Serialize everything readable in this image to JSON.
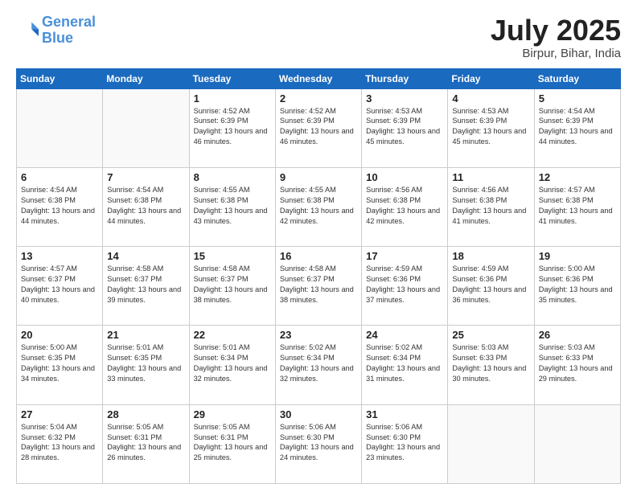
{
  "header": {
    "logo": {
      "line1": "General",
      "line2": "Blue"
    },
    "title": "July 2025",
    "location": "Birpur, Bihar, India"
  },
  "weekdays": [
    "Sunday",
    "Monday",
    "Tuesday",
    "Wednesday",
    "Thursday",
    "Friday",
    "Saturday"
  ],
  "weeks": [
    [
      {
        "day": "",
        "sunrise": "",
        "sunset": "",
        "daylight": ""
      },
      {
        "day": "",
        "sunrise": "",
        "sunset": "",
        "daylight": ""
      },
      {
        "day": "1",
        "sunrise": "Sunrise: 4:52 AM",
        "sunset": "Sunset: 6:39 PM",
        "daylight": "Daylight: 13 hours and 46 minutes."
      },
      {
        "day": "2",
        "sunrise": "Sunrise: 4:52 AM",
        "sunset": "Sunset: 6:39 PM",
        "daylight": "Daylight: 13 hours and 46 minutes."
      },
      {
        "day": "3",
        "sunrise": "Sunrise: 4:53 AM",
        "sunset": "Sunset: 6:39 PM",
        "daylight": "Daylight: 13 hours and 45 minutes."
      },
      {
        "day": "4",
        "sunrise": "Sunrise: 4:53 AM",
        "sunset": "Sunset: 6:39 PM",
        "daylight": "Daylight: 13 hours and 45 minutes."
      },
      {
        "day": "5",
        "sunrise": "Sunrise: 4:54 AM",
        "sunset": "Sunset: 6:39 PM",
        "daylight": "Daylight: 13 hours and 44 minutes."
      }
    ],
    [
      {
        "day": "6",
        "sunrise": "Sunrise: 4:54 AM",
        "sunset": "Sunset: 6:38 PM",
        "daylight": "Daylight: 13 hours and 44 minutes."
      },
      {
        "day": "7",
        "sunrise": "Sunrise: 4:54 AM",
        "sunset": "Sunset: 6:38 PM",
        "daylight": "Daylight: 13 hours and 44 minutes."
      },
      {
        "day": "8",
        "sunrise": "Sunrise: 4:55 AM",
        "sunset": "Sunset: 6:38 PM",
        "daylight": "Daylight: 13 hours and 43 minutes."
      },
      {
        "day": "9",
        "sunrise": "Sunrise: 4:55 AM",
        "sunset": "Sunset: 6:38 PM",
        "daylight": "Daylight: 13 hours and 42 minutes."
      },
      {
        "day": "10",
        "sunrise": "Sunrise: 4:56 AM",
        "sunset": "Sunset: 6:38 PM",
        "daylight": "Daylight: 13 hours and 42 minutes."
      },
      {
        "day": "11",
        "sunrise": "Sunrise: 4:56 AM",
        "sunset": "Sunset: 6:38 PM",
        "daylight": "Daylight: 13 hours and 41 minutes."
      },
      {
        "day": "12",
        "sunrise": "Sunrise: 4:57 AM",
        "sunset": "Sunset: 6:38 PM",
        "daylight": "Daylight: 13 hours and 41 minutes."
      }
    ],
    [
      {
        "day": "13",
        "sunrise": "Sunrise: 4:57 AM",
        "sunset": "Sunset: 6:37 PM",
        "daylight": "Daylight: 13 hours and 40 minutes."
      },
      {
        "day": "14",
        "sunrise": "Sunrise: 4:58 AM",
        "sunset": "Sunset: 6:37 PM",
        "daylight": "Daylight: 13 hours and 39 minutes."
      },
      {
        "day": "15",
        "sunrise": "Sunrise: 4:58 AM",
        "sunset": "Sunset: 6:37 PM",
        "daylight": "Daylight: 13 hours and 38 minutes."
      },
      {
        "day": "16",
        "sunrise": "Sunrise: 4:58 AM",
        "sunset": "Sunset: 6:37 PM",
        "daylight": "Daylight: 13 hours and 38 minutes."
      },
      {
        "day": "17",
        "sunrise": "Sunrise: 4:59 AM",
        "sunset": "Sunset: 6:36 PM",
        "daylight": "Daylight: 13 hours and 37 minutes."
      },
      {
        "day": "18",
        "sunrise": "Sunrise: 4:59 AM",
        "sunset": "Sunset: 6:36 PM",
        "daylight": "Daylight: 13 hours and 36 minutes."
      },
      {
        "day": "19",
        "sunrise": "Sunrise: 5:00 AM",
        "sunset": "Sunset: 6:36 PM",
        "daylight": "Daylight: 13 hours and 35 minutes."
      }
    ],
    [
      {
        "day": "20",
        "sunrise": "Sunrise: 5:00 AM",
        "sunset": "Sunset: 6:35 PM",
        "daylight": "Daylight: 13 hours and 34 minutes."
      },
      {
        "day": "21",
        "sunrise": "Sunrise: 5:01 AM",
        "sunset": "Sunset: 6:35 PM",
        "daylight": "Daylight: 13 hours and 33 minutes."
      },
      {
        "day": "22",
        "sunrise": "Sunrise: 5:01 AM",
        "sunset": "Sunset: 6:34 PM",
        "daylight": "Daylight: 13 hours and 32 minutes."
      },
      {
        "day": "23",
        "sunrise": "Sunrise: 5:02 AM",
        "sunset": "Sunset: 6:34 PM",
        "daylight": "Daylight: 13 hours and 32 minutes."
      },
      {
        "day": "24",
        "sunrise": "Sunrise: 5:02 AM",
        "sunset": "Sunset: 6:34 PM",
        "daylight": "Daylight: 13 hours and 31 minutes."
      },
      {
        "day": "25",
        "sunrise": "Sunrise: 5:03 AM",
        "sunset": "Sunset: 6:33 PM",
        "daylight": "Daylight: 13 hours and 30 minutes."
      },
      {
        "day": "26",
        "sunrise": "Sunrise: 5:03 AM",
        "sunset": "Sunset: 6:33 PM",
        "daylight": "Daylight: 13 hours and 29 minutes."
      }
    ],
    [
      {
        "day": "27",
        "sunrise": "Sunrise: 5:04 AM",
        "sunset": "Sunset: 6:32 PM",
        "daylight": "Daylight: 13 hours and 28 minutes."
      },
      {
        "day": "28",
        "sunrise": "Sunrise: 5:05 AM",
        "sunset": "Sunset: 6:31 PM",
        "daylight": "Daylight: 13 hours and 26 minutes."
      },
      {
        "day": "29",
        "sunrise": "Sunrise: 5:05 AM",
        "sunset": "Sunset: 6:31 PM",
        "daylight": "Daylight: 13 hours and 25 minutes."
      },
      {
        "day": "30",
        "sunrise": "Sunrise: 5:06 AM",
        "sunset": "Sunset: 6:30 PM",
        "daylight": "Daylight: 13 hours and 24 minutes."
      },
      {
        "day": "31",
        "sunrise": "Sunrise: 5:06 AM",
        "sunset": "Sunset: 6:30 PM",
        "daylight": "Daylight: 13 hours and 23 minutes."
      },
      {
        "day": "",
        "sunrise": "",
        "sunset": "",
        "daylight": ""
      },
      {
        "day": "",
        "sunrise": "",
        "sunset": "",
        "daylight": ""
      }
    ]
  ]
}
